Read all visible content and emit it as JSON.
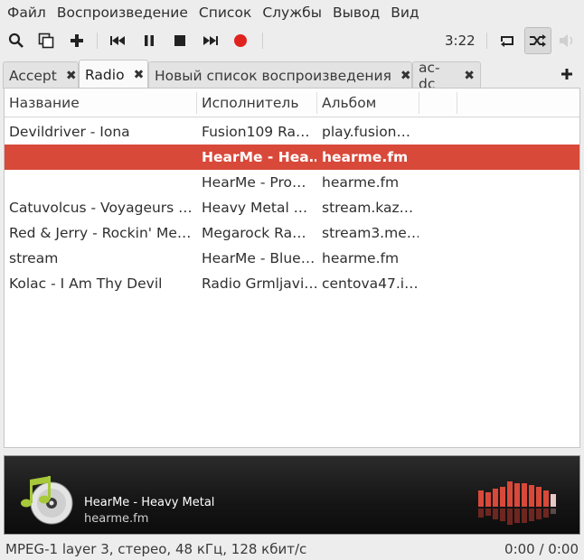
{
  "menubar": {
    "items": [
      {
        "label": "Файл"
      },
      {
        "label": "Воспроизведение"
      },
      {
        "label": "Список"
      },
      {
        "label": "Службы"
      },
      {
        "label": "Вывод"
      },
      {
        "label": "Вид"
      }
    ]
  },
  "toolbar": {
    "time": "3:22",
    "icons": [
      "search-icon",
      "copy-icon",
      "add-icon",
      "previous-icon",
      "pause-icon",
      "stop-icon",
      "next-icon",
      "record-icon",
      "repeat-icon",
      "shuffle-icon",
      "volume-icon"
    ]
  },
  "tabs": [
    {
      "label": "Accept"
    },
    {
      "label": "Radio"
    },
    {
      "label": "Новый список воспроизведения"
    },
    {
      "label": "ac-dc"
    }
  ],
  "playlist": {
    "columns": [
      "Название",
      "Исполнитель",
      "Альбом"
    ],
    "rows": [
      [
        "Devildriver - Iona",
        "Fusion109 Ra…",
        "play.fusion…"
      ],
      [
        "",
        "HearMe - Hea…",
        "hearme.fm"
      ],
      [
        "",
        "HearMe - Pro…",
        "hearme.fm"
      ],
      [
        "Catuvolcus - Voyageurs …",
        "Heavy Metal …",
        "stream.kaz…"
      ],
      [
        "Red & Jerry - Rockin' Me…",
        "Megarock Ra…",
        "stream3.me…"
      ],
      [
        "stream",
        "HearMe - Blue…",
        "hearme.fm"
      ],
      [
        "Kolac - I Am Thy Devil",
        "Radio Grmljavi…",
        "centova47.i…"
      ]
    ],
    "selected_row": 1
  },
  "now_playing": {
    "title": "HearMe - Heavy Metal",
    "subtitle": "hearme.fm"
  },
  "status": {
    "format": "MPEG-1 layer 3, стерео, 48 кГц, 128 кбит/с",
    "time": "0:00 / 0:00"
  },
  "colors": {
    "accent": "#d8493a",
    "record": "#e0231f",
    "visualizer": "#e6695c"
  }
}
